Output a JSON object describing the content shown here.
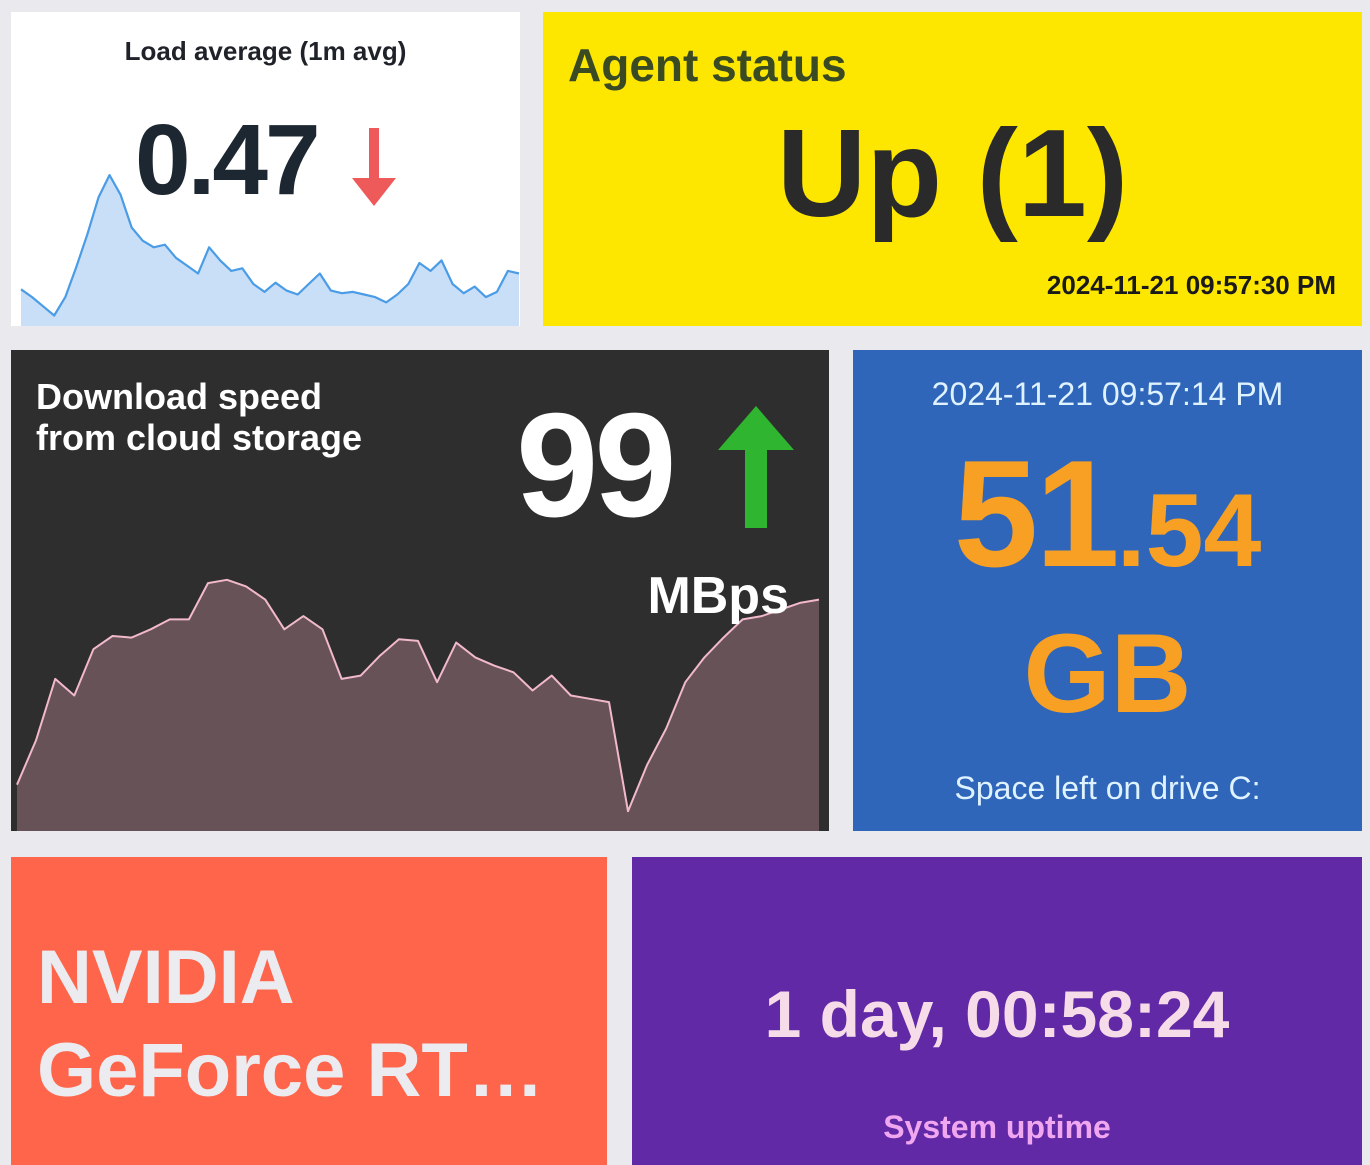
{
  "load_average": {
    "title": "Load average (1m avg)",
    "value": "0.47",
    "trend": "down",
    "trend_color": "#ee5a5a",
    "series": [
      0.28,
      0.22,
      0.15,
      0.08,
      0.22,
      0.45,
      0.7,
      0.98,
      1.15,
      1.0,
      0.75,
      0.65,
      0.6,
      0.62,
      0.52,
      0.46,
      0.4,
      0.6,
      0.5,
      0.42,
      0.44,
      0.32,
      0.26,
      0.33,
      0.27,
      0.24,
      0.32,
      0.4,
      0.27,
      0.25,
      0.26,
      0.24,
      0.22,
      0.18,
      0.24,
      0.32,
      0.48,
      0.42,
      0.5,
      0.32,
      0.25,
      0.3,
      0.22,
      0.26,
      0.42,
      0.4
    ]
  },
  "agent_status": {
    "title": "Agent status",
    "value": "Up (1)",
    "timestamp": "2024-11-21 09:57:30 PM"
  },
  "download_speed": {
    "title": "Download speed from cloud storage",
    "value": "99",
    "units": "MBps",
    "trend": "up",
    "trend_color": "#2fb52f",
    "series": [
      0.28,
      0.55,
      0.92,
      0.82,
      1.1,
      1.18,
      1.17,
      1.22,
      1.28,
      1.28,
      1.5,
      1.52,
      1.48,
      1.4,
      1.22,
      1.3,
      1.22,
      0.92,
      0.94,
      1.06,
      1.16,
      1.15,
      0.9,
      1.14,
      1.05,
      1.0,
      0.96,
      0.85,
      0.94,
      0.82,
      0.8,
      0.78,
      0.12,
      0.4,
      0.62,
      0.9,
      1.05,
      1.17,
      1.28,
      1.3,
      1.34,
      1.38,
      1.4
    ]
  },
  "drive_space": {
    "timestamp": "2024-11-21 09:57:14 PM",
    "value_int": "51",
    "value_dec": ".54",
    "unit": "GB",
    "description": "Space left on drive C:"
  },
  "gpu": {
    "value": "NVIDIA GeForce RT…"
  },
  "uptime": {
    "value": "1 day, 00:58:24",
    "description": "System uptime"
  }
}
